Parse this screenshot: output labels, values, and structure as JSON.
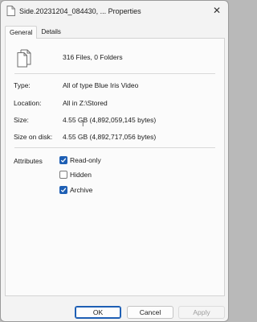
{
  "window": {
    "title": "Side.20231204_084430, ... Properties",
    "close_glyph": "✕"
  },
  "tabs": [
    {
      "label": "General",
      "active": true
    },
    {
      "label": "Details",
      "active": false
    }
  ],
  "general": {
    "file_icon": "files-icon",
    "count_text": "316 Files, 0 Folders",
    "rows": [
      {
        "label": "Type:",
        "value": "All of type Blue Iris Video"
      },
      {
        "label": "Location:",
        "value": "All in Z:\\Stored"
      },
      {
        "label": "Size:",
        "value": "4.55 GB (4,892,059,145 bytes)"
      },
      {
        "label": "Size on disk:",
        "value": "4.55 GB (4,892,717,056 bytes)"
      }
    ],
    "attributes_label": "Attributes",
    "attributes": [
      {
        "label": "Read-only",
        "checked": true
      },
      {
        "label": "Hidden",
        "checked": false
      },
      {
        "label": "Archive",
        "checked": true
      }
    ]
  },
  "buttons": {
    "ok": "OK",
    "cancel": "Cancel",
    "apply": "Apply"
  },
  "colors": {
    "accent": "#1e5fb4",
    "panel": "#fbfbfb",
    "window": "#f3f3f3"
  }
}
